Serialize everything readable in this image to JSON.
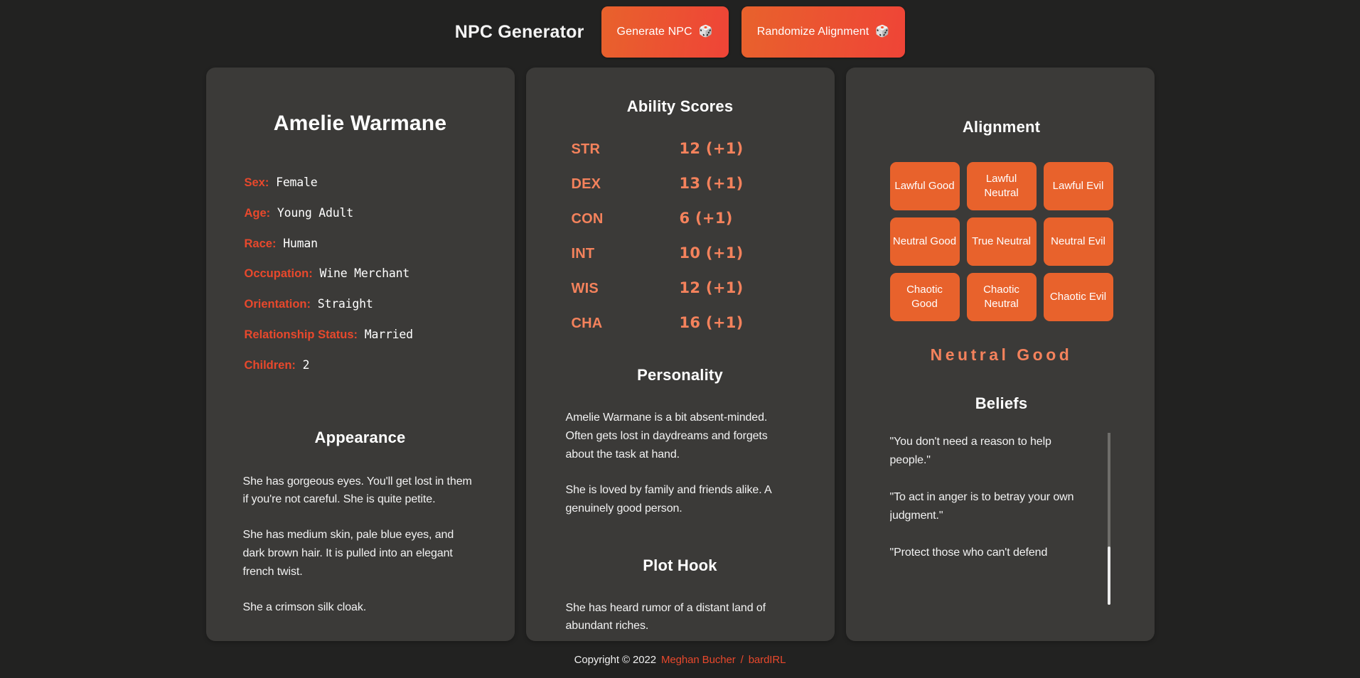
{
  "header": {
    "app_title": "NPC Generator",
    "generate_button": {
      "label": "Generate NPC",
      "icon": "dice-icon",
      "glyph": "🎲"
    },
    "randomize_button": {
      "label": "Randomize Alignment",
      "icon": "dice-icon",
      "glyph": "🎲"
    }
  },
  "npc": {
    "name": "Amelie Warmane",
    "details": [
      {
        "label": "Sex:",
        "value": "Female"
      },
      {
        "label": "Age:",
        "value": "Young Adult"
      },
      {
        "label": "Race:",
        "value": "Human"
      },
      {
        "label": "Occupation:",
        "value": "Wine Merchant"
      },
      {
        "label": "Orientation:",
        "value": "Straight"
      },
      {
        "label": "Relationship Status:",
        "value": "Married"
      },
      {
        "label": "Children:",
        "value": "2"
      }
    ],
    "appearance": {
      "title": "Appearance",
      "paragraphs": [
        "She has gorgeous eyes. You'll get lost in them if you're not careful. She is quite petite.",
        "She has medium skin, pale blue eyes, and dark brown hair. It is pulled into an elegant french twist.",
        "She a crimson silk cloak."
      ]
    }
  },
  "abilities": {
    "title": "Ability Scores",
    "scores": [
      {
        "abbr": "STR",
        "value": "12 (+1)"
      },
      {
        "abbr": "DEX",
        "value": "13 (+1)"
      },
      {
        "abbr": "CON",
        "value": "6 (+1)"
      },
      {
        "abbr": "INT",
        "value": "10 (+1)"
      },
      {
        "abbr": "WIS",
        "value": "12 (+1)"
      },
      {
        "abbr": "CHA",
        "value": "16 (+1)"
      }
    ]
  },
  "personality": {
    "title": "Personality",
    "paragraphs": [
      "Amelie Warmane is a bit absent-minded. Often gets lost in daydreams and forgets about the task at hand.",
      "She is loved by family and friends alike. A genuinely good person."
    ]
  },
  "plot_hook": {
    "title": "Plot Hook",
    "paragraphs": [
      "She has heard rumor of a distant land of abundant riches."
    ]
  },
  "alignment": {
    "title": "Alignment",
    "options": [
      "Lawful Good",
      "Lawful Neutral",
      "Lawful Evil",
      "Neutral Good",
      "True Neutral",
      "Neutral Evil",
      "Chaotic Good",
      "Chaotic Neutral",
      "Chaotic Evil"
    ],
    "selected": "Neutral Good"
  },
  "beliefs": {
    "title": "Beliefs",
    "items": [
      "\"You don't need a reason to help people.\"",
      "\"To act in anger is to betray your own judgment.\"",
      "\"Protect those who can't defend"
    ]
  },
  "footer": {
    "copyright": "Copyright © 2022",
    "author": "Meghan Bucher",
    "separator": "/",
    "site": "bardIRL"
  },
  "colors": {
    "background": "#222221",
    "card": "#3b3a38",
    "accent_red": "#e8482c",
    "accent_orange": "#e8622c",
    "accent_salmon": "#f4825c",
    "text": "#ffffff"
  }
}
